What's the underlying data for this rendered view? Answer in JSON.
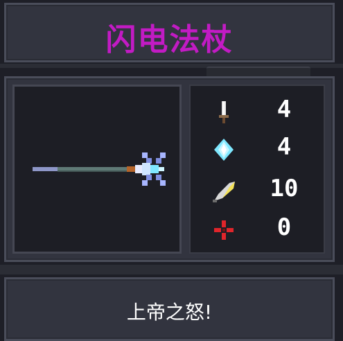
{
  "item": {
    "title": "闪电法杖",
    "title_color": "#c21bc4",
    "description": "上帝之怒!"
  },
  "stats": [
    {
      "icon": "sword-icon",
      "value": "4"
    },
    {
      "icon": "crystal-icon",
      "value": "4"
    },
    {
      "icon": "feather-icon",
      "value": "10"
    },
    {
      "icon": "crosshair-icon",
      "value": "0"
    }
  ],
  "colors": {
    "panel": "#32343f",
    "frame": "#1d1e25",
    "crosshair": "#e0252b",
    "crystal": "#7fe8ff",
    "feather": "#f3e25a"
  }
}
